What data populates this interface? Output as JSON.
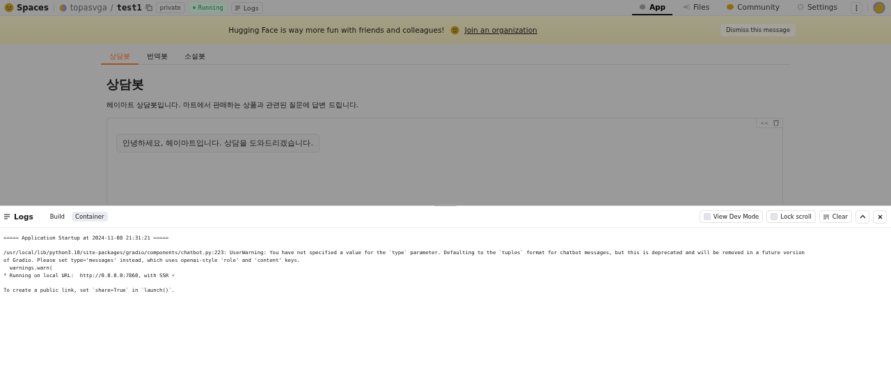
{
  "header": {
    "brand": "Spaces",
    "owner": "topasvga",
    "separator": "/",
    "repo": "test1",
    "visibility": "private",
    "status": "Running",
    "logs_button": "Logs",
    "nav": [
      {
        "label": "App",
        "kind": "app",
        "selected": true
      },
      {
        "label": "Files",
        "kind": "files",
        "selected": false
      },
      {
        "label": "Community",
        "kind": "community",
        "selected": false
      },
      {
        "label": "Settings",
        "kind": "settings",
        "selected": false
      }
    ]
  },
  "banner": {
    "message": "Hugging Face is way more fun with friends and colleagues!",
    "link": "Join an organization",
    "dismiss": "Dismiss this message"
  },
  "app": {
    "tabs": [
      {
        "label": "상담봇",
        "selected": true
      },
      {
        "label": "번역봇",
        "selected": false
      },
      {
        "label": "소설봇",
        "selected": false
      }
    ],
    "title": "상담봇",
    "description": "헤이마트 상담봇입니다. 마트에서 판매하는 상품과 관련된 질문에 답변 드립니다.",
    "chat_controls": [
      "<<"
    ],
    "messages": [
      "안녕하세요, 헤이마트입니다. 상담을 도와드리겠습니다."
    ]
  },
  "logs": {
    "title": "Logs",
    "tabs": [
      {
        "label": "Build",
        "selected": false
      },
      {
        "label": "Container",
        "selected": true
      }
    ],
    "options": [
      {
        "label": "View Dev Mode",
        "checked": false
      },
      {
        "label": "Lock scroll",
        "checked": false
      }
    ],
    "clear": "Clear",
    "blocks": [
      [
        "===== Application Startup at 2024-11-08 21:31:21 ====="
      ],
      [
        "/usr/local/lib/python3.10/site-packages/gradio/components/chatbot.py:223: UserWarning: You have not specified a value for the `type` parameter. Defaulting to the `tuples` format for chatbot messages, but this is deprecated and will be removed in a future version",
        "of Gradio. Please set type='messages' instead, which uses openai-style 'role' and 'content' keys.",
        "  warnings.warn(",
        "* Running on local URL:  http://0.0.0.0:7860, with SSR ⚡"
      ],
      [
        "To create a public link, set `share=True` in `launch()`."
      ]
    ]
  }
}
